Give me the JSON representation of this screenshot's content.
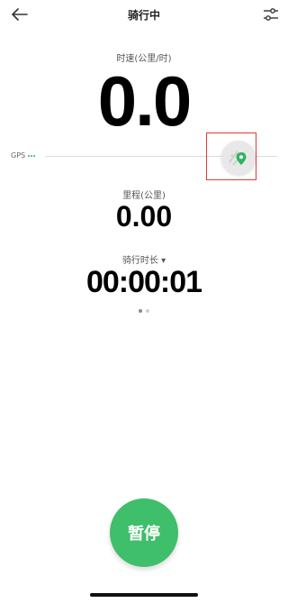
{
  "header": {
    "title": "骑行中",
    "back_icon": "back-arrow-icon",
    "settings_icon": "sliders-icon"
  },
  "speed": {
    "label": "时速(公里/时)",
    "value": "0.0"
  },
  "gps": {
    "label": "GPS",
    "signal_color": "#2fb55d"
  },
  "map_button": {
    "icon": "map-pin-icon",
    "pin_color": "#2fb55d",
    "highlight_color": "#e53935"
  },
  "distance": {
    "label": "里程(公里)",
    "value": "0.00"
  },
  "duration": {
    "label": "骑行时长 ▾",
    "value": "00:00:01"
  },
  "pager": {
    "count": 2,
    "active_index": 0
  },
  "actions": {
    "pause_label": "暂停",
    "pause_color": "#3fbe6b"
  }
}
